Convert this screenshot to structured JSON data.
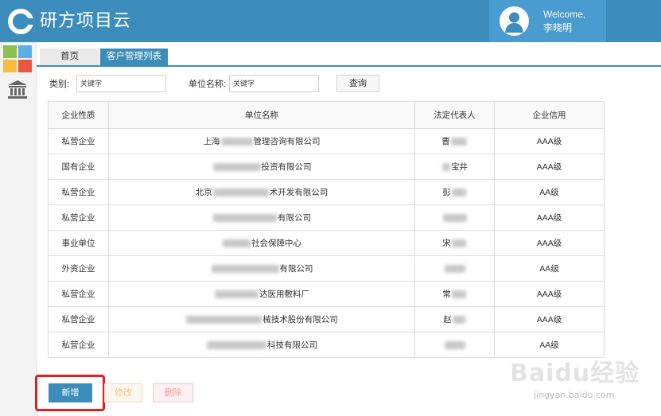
{
  "app": {
    "title": "研方项目云"
  },
  "user": {
    "welcome": "Welcome,",
    "name": "李晓明"
  },
  "tabs": [
    {
      "label": "首页",
      "active": false
    },
    {
      "label": "客户管理列表",
      "active": true
    }
  ],
  "search": {
    "type_label": "类别:",
    "type_placeholder": "关键字",
    "unit_label": "单位名称:",
    "unit_placeholder": "关键字",
    "query_button": "查询"
  },
  "table": {
    "headers": [
      "企业性质",
      "单位名称",
      "法定代表人",
      "企业信用"
    ],
    "rows": [
      {
        "nature": "私营企业",
        "name_pre": "上海",
        "name_suf": "管理咨询有限公司",
        "rep_pre": "曹",
        "rep_suf": "",
        "credit": "AAA级"
      },
      {
        "nature": "国有企业",
        "name_pre": "",
        "name_suf": "投资有限公司",
        "rep_pre": "",
        "rep_suf": "宝井",
        "credit": "AAA级"
      },
      {
        "nature": "私营企业",
        "name_pre": "北京",
        "name_suf": "术开发有限公司",
        "rep_pre": "彭",
        "rep_suf": "",
        "credit": "AA级"
      },
      {
        "nature": "私营企业",
        "name_pre": "",
        "name_suf": "有限公司",
        "rep_pre": "",
        "rep_suf": "",
        "credit": "AAA级"
      },
      {
        "nature": "事业单位",
        "name_pre": "",
        "name_suf": "社会保障中心",
        "rep_pre": "宋",
        "rep_suf": "",
        "credit": "AAA级"
      },
      {
        "nature": "外资企业",
        "name_pre": "",
        "name_suf": "有限公司",
        "rep_pre": "",
        "rep_suf": "",
        "credit": "AA级"
      },
      {
        "nature": "私营企业",
        "name_pre": "",
        "name_suf": "达医用敷料厂",
        "rep_pre": "常",
        "rep_suf": "",
        "credit": "AAA级"
      },
      {
        "nature": "私营企业",
        "name_pre": "",
        "name_suf": "械技术股份有限公司",
        "rep_pre": "赵",
        "rep_suf": "",
        "credit": "AAA级"
      },
      {
        "nature": "私营企业",
        "name_pre": "",
        "name_suf": "科技有限公司",
        "rep_pre": "",
        "rep_suf": "",
        "credit": "AA级"
      }
    ]
  },
  "actions": {
    "add": "新增",
    "edit": "修改",
    "delete": "删除"
  },
  "watermark": {
    "brand": "Baidu经验",
    "url": "jingyan.baidu.com"
  },
  "colors": {
    "header": "#3c8dbc",
    "accent": "#3c8dbc",
    "highlight": "#e02020"
  },
  "icons": {
    "logo": "ring-logo-icon",
    "avatar": "user-avatar-icon",
    "apps": "app-tiles-icon",
    "bank": "bank-icon"
  }
}
